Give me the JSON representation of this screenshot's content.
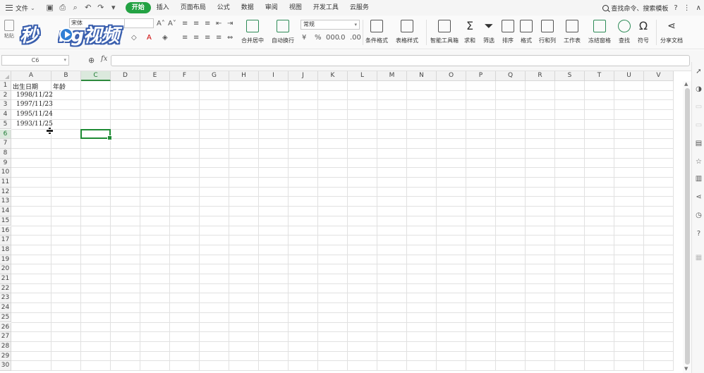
{
  "menubar": {
    "file_label": "文件",
    "tabs": [
      {
        "label": "开始",
        "active": true
      },
      {
        "label": "插入"
      },
      {
        "label": "页面布局"
      },
      {
        "label": "公式"
      },
      {
        "label": "数据"
      },
      {
        "label": "审阅"
      },
      {
        "label": "视图"
      },
      {
        "label": "开发工具"
      },
      {
        "label": "云服务"
      }
    ],
    "search_label": "查找命令、搜索模板",
    "accent_color": "#23a243"
  },
  "ribbon": {
    "paste_label": "粘贴",
    "font_name": "宋体",
    "merge_label": "合并居中",
    "wrap_label": "自动换行",
    "number_format": "常规",
    "conditional_format_label": "条件格式",
    "table_style_label": "表格样式",
    "smart_toolbox_label": "智能工具箱",
    "sum_label": "求和",
    "filter_label": "筛选",
    "sort_label": "排序",
    "format_label": "格式",
    "rowcol_label": "行和列",
    "worksheet_label": "工作表",
    "freeze_label": "冻结窗格",
    "find_label": "查找",
    "symbol_label": "符号",
    "share_label": "分享文档"
  },
  "watermark": {
    "text_left": "秒",
    "text_mid": "ng",
    "text_right": "视频"
  },
  "formulabar": {
    "cell_ref": "C6",
    "fx_label": "fx",
    "formula": ""
  },
  "sheet": {
    "columns": [
      "A",
      "B",
      "C",
      "D",
      "E",
      "F",
      "G",
      "H",
      "I",
      "J",
      "K",
      "L",
      "M",
      "N",
      "O",
      "P",
      "Q",
      "R",
      "S",
      "T",
      "U",
      "V"
    ],
    "rows": [
      "1",
      "2",
      "3",
      "4",
      "5",
      "6",
      "7",
      "8",
      "9",
      "10",
      "11",
      "12",
      "13",
      "14",
      "15",
      "16",
      "17",
      "18",
      "19",
      "20",
      "21",
      "22",
      "23",
      "24",
      "25",
      "26",
      "27",
      "28",
      "29",
      "30"
    ],
    "cells": {
      "A1": "出生日期",
      "B1": "年龄",
      "A2": "1998/11/22",
      "A3": "1997/11/23",
      "A4": "1995/11/24",
      "A5": "1993/11/25"
    },
    "selected_cell": "C6"
  }
}
